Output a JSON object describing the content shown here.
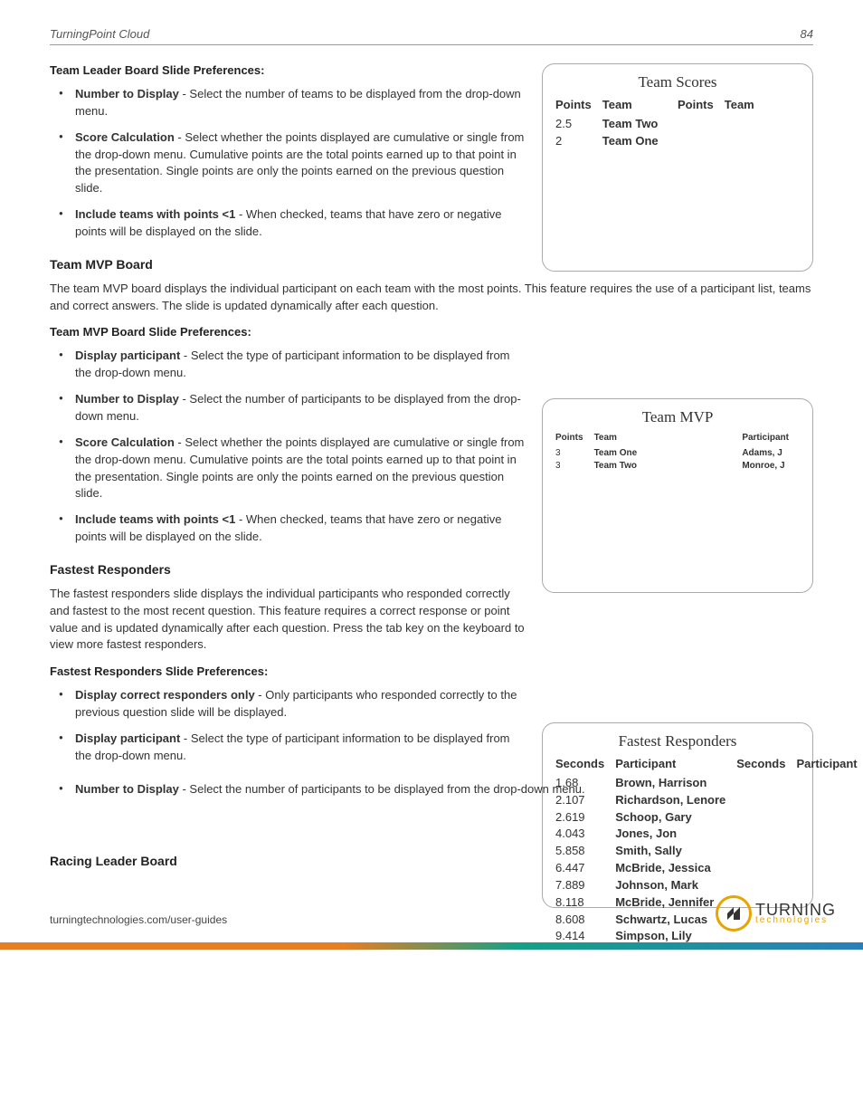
{
  "header": {
    "title": "TurningPoint Cloud",
    "page": "84"
  },
  "section1": {
    "heading": "Team Leader Board Slide Preferences:",
    "items": [
      {
        "label": "Number to Display",
        "text": " - Select the number of teams to be displayed from the drop-down menu."
      },
      {
        "label": "Score Calculation",
        "text": " - Select whether the points displayed are cumulative or single from the drop-down menu. Cumulative points are the total points earned up to that point in the presentation. Single points are only the points earned on the previous question slide."
      },
      {
        "label": "Include teams with points <1",
        "text": " - When checked, teams that have zero or negative points will be displayed on the slide."
      }
    ]
  },
  "section2": {
    "title": "Team MVP Board",
    "intro": "The team MVP board displays the individual participant on each team with the most points. This feature requires the use of a participant list, teams and correct answers. The slide is updated dynamically after each question.",
    "heading": "Team MVP Board Slide Preferences:",
    "items": [
      {
        "label": "Display participant",
        "text": " - Select the type of participant information to be displayed from the drop-down menu."
      },
      {
        "label": "Number to Display",
        "text": " - Select the number of participants to be displayed from the drop-down menu."
      },
      {
        "label": "Score Calculation",
        "text": " - Select whether the points displayed are cumulative or single from the drop-down menu. Cumulative points are the total points earned up to that point in the presentation. Single points are only the points earned on the previous question slide."
      },
      {
        "label": "Include teams with points <1",
        "text": " - When checked, teams that have zero or negative points will be displayed on the slide."
      }
    ]
  },
  "section3": {
    "title": "Fastest Responders",
    "intro": "The fastest responders slide displays the individual participants who responded correctly and fastest to the most recent question. This feature requires a correct response or point value and is updated dynamically after each question. Press the tab key on the keyboard to view more fastest responders.",
    "heading": "Fastest Responders Slide Preferences:",
    "items": [
      {
        "label": "Display correct responders only",
        "text": " - Only participants who responded correctly to the previous question slide will be displayed."
      },
      {
        "label": "Display participant",
        "text": " - Select the type of participant information to be displayed from the drop-down menu."
      },
      {
        "label": "Number to Display",
        "text": " - Select the number of participants to be displayed from the drop-down menu."
      }
    ]
  },
  "section4": {
    "title": "Racing Leader Board"
  },
  "panel1": {
    "title": "Team Scores",
    "cols": {
      "points": "Points",
      "team": "Team"
    },
    "rows": [
      {
        "points": "2.5",
        "team": "Team Two"
      },
      {
        "points": "2",
        "team": "Team One"
      }
    ]
  },
  "panel2": {
    "title": "Team MVP",
    "cols": {
      "points": "Points",
      "team": "Team",
      "participant": "Participant"
    },
    "rows": [
      {
        "points": "3",
        "team": "Team One",
        "participant": "Adams, J"
      },
      {
        "points": "3",
        "team": "Team Two",
        "participant": "Monroe, J"
      }
    ]
  },
  "panel3": {
    "title": "Fastest Responders",
    "cols": {
      "seconds": "Seconds",
      "participant": "Participant"
    },
    "rows": [
      {
        "seconds": "1.68",
        "participant": "Brown, Harrison"
      },
      {
        "seconds": "2.107",
        "participant": "Richardson, Lenore"
      },
      {
        "seconds": "2.619",
        "participant": "Schoop, Gary"
      },
      {
        "seconds": "4.043",
        "participant": "Jones, Jon"
      },
      {
        "seconds": "5.858",
        "participant": "Smith, Sally"
      },
      {
        "seconds": "6.447",
        "participant": "McBride, Jessica"
      },
      {
        "seconds": "7.889",
        "participant": "Johnson, Mark"
      },
      {
        "seconds": "8.118",
        "participant": "McBride, Jennifer"
      },
      {
        "seconds": "8.608",
        "participant": "Schwartz, Lucas"
      },
      {
        "seconds": "9.414",
        "participant": "Simpson, Lily"
      }
    ]
  },
  "footer": {
    "url": "turningtechnologies.com/user-guides",
    "logo_big": "TURNING",
    "logo_small": "technologies"
  }
}
